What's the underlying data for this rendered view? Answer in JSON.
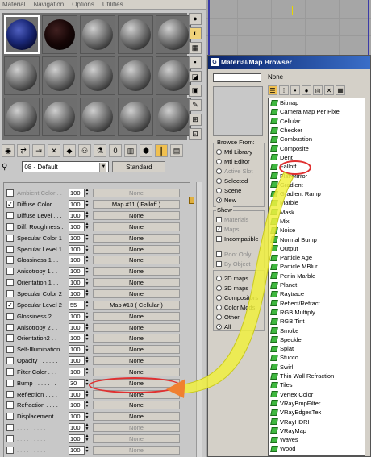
{
  "menubar": [
    "Material",
    "Navigation",
    "Options",
    "Utilities"
  ],
  "slots": [
    "blue",
    "red",
    "gray",
    "gray",
    "gray",
    "gray",
    "gray",
    "gray",
    "gray",
    "gray",
    "gray",
    "gray",
    "gray",
    "gray",
    "gray"
  ],
  "material": {
    "name": "08 - Default",
    "type_button": "Standard"
  },
  "maps": [
    {
      "label": "Ambient Color . .",
      "checked": false,
      "amount": "100",
      "map": "None",
      "disabled": true
    },
    {
      "label": "Diffuse Color . . .",
      "checked": true,
      "amount": "100",
      "map": "Map #11  ( Falloff )",
      "disabled": false
    },
    {
      "label": "Diffuse Level . . .",
      "checked": false,
      "amount": "100",
      "map": "None",
      "disabled": false
    },
    {
      "label": "Diff. Roughness .",
      "checked": false,
      "amount": "100",
      "map": "None",
      "disabled": false
    },
    {
      "label": "Specular Color 1",
      "checked": false,
      "amount": "100",
      "map": "None",
      "disabled": false
    },
    {
      "label": "Specular Level 1",
      "checked": false,
      "amount": "100",
      "map": "None",
      "disabled": false
    },
    {
      "label": "Glossiness 1 . .",
      "checked": false,
      "amount": "100",
      "map": "None",
      "disabled": false
    },
    {
      "label": "Anisotropy 1 . .",
      "checked": false,
      "amount": "100",
      "map": "None",
      "disabled": false
    },
    {
      "label": "Orientation 1 . .",
      "checked": false,
      "amount": "100",
      "map": "None",
      "disabled": false
    },
    {
      "label": "Specular Color 2",
      "checked": false,
      "amount": "100",
      "map": "None",
      "disabled": false
    },
    {
      "label": "Specular Level 2",
      "checked": true,
      "amount": "55",
      "map": "Map #13  ( Cellular )",
      "disabled": false
    },
    {
      "label": "Glossiness 2 . .",
      "checked": false,
      "amount": "100",
      "map": "None",
      "disabled": false
    },
    {
      "label": "Anisotropy 2 . .",
      "checked": false,
      "amount": "100",
      "map": "None",
      "disabled": false
    },
    {
      "label": "Orientation2 . .",
      "checked": false,
      "amount": "100",
      "map": "None",
      "disabled": false
    },
    {
      "label": "Self-Illumination .",
      "checked": false,
      "amount": "100",
      "map": "None",
      "disabled": false
    },
    {
      "label": "Opacity . . . . . .",
      "checked": false,
      "amount": "100",
      "map": "None",
      "disabled": false
    },
    {
      "label": "Filter Color . . .",
      "checked": false,
      "amount": "100",
      "map": "None",
      "disabled": false
    },
    {
      "label": "Bump . . . . . . .",
      "checked": false,
      "amount": "30",
      "map": "None",
      "disabled": false
    },
    {
      "label": "Reflection . . . .",
      "checked": false,
      "amount": "100",
      "map": "None",
      "disabled": false
    },
    {
      "label": "Refraction . . . .",
      "checked": false,
      "amount": "100",
      "map": "None",
      "disabled": false
    },
    {
      "label": "Displacement . .",
      "checked": false,
      "amount": "100",
      "map": "None",
      "disabled": false
    },
    {
      "label": ". . . . . . . . . .",
      "checked": false,
      "amount": "100",
      "map": "None",
      "disabled": true
    },
    {
      "label": ". . . . . . . . . .",
      "checked": false,
      "amount": "100",
      "map": "None",
      "disabled": true
    },
    {
      "label": ". . . . . . . . . .",
      "checked": false,
      "amount": "100",
      "map": "None",
      "disabled": true
    },
    {
      "label": ". . . . . . . . . .",
      "checked": false,
      "amount": "100",
      "map": "None",
      "disabled": true
    }
  ],
  "browser": {
    "title": "Material/Map Browser",
    "selected": "None",
    "browse_from": {
      "title": "Browse From:",
      "options": [
        "Mtl Library",
        "Mtl Editor",
        "Active Slot",
        "Selected",
        "Scene",
        "New"
      ],
      "selected": "New",
      "disabled": [
        "Active Slot"
      ]
    },
    "show": {
      "title": "Show",
      "options": [
        {
          "label": "Materials",
          "checked": false,
          "disabled": true
        },
        {
          "label": "Maps",
          "checked": true,
          "disabled": true
        },
        {
          "label": "Incompatible",
          "checked": false,
          "disabled": false
        }
      ],
      "root": [
        {
          "label": "Root Only",
          "checked": false
        },
        {
          "label": "By Object",
          "checked": false
        }
      ]
    },
    "filter": {
      "options": [
        "2D maps",
        "3D maps",
        "Compositors",
        "Color Mods",
        "Other",
        "All"
      ],
      "selected": "All"
    },
    "maps": [
      "Bitmap",
      "Camera Map Per Pixel",
      "Cellular",
      "Checker",
      "Combustion",
      "Composite",
      "Dent",
      "Falloff",
      "Flat Mirror",
      "Gradient",
      "Gradient Ramp",
      "Marble",
      "Mask",
      "Mix",
      "Noise",
      "Normal Bump",
      "Output",
      "Particle Age",
      "Particle MBlur",
      "Perlin Marble",
      "Planet",
      "Raytrace",
      "Reflect/Refract",
      "RGB Multiply",
      "RGB Tint",
      "Smoke",
      "Speckle",
      "Splat",
      "Stucco",
      "Swirl",
      "Thin Wall Refraction",
      "Tiles",
      "Vertex Color",
      "VRayBmpFilter",
      "VRayEdgesTex",
      "VRayHDRI",
      "VRayMap",
      "Waves",
      "Wood"
    ]
  },
  "colors": {
    "accent": "#0a246a",
    "highlight": "#e03030",
    "arrow": "#f0f040"
  }
}
